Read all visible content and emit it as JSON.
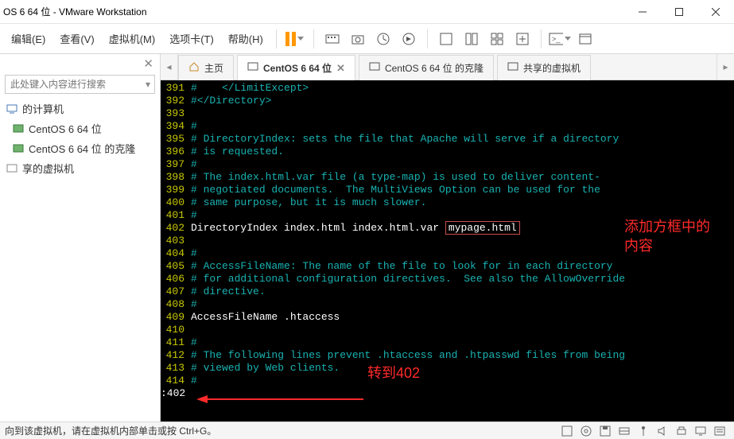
{
  "title": "OS 6 64 位 - VMware Workstation",
  "menus": {
    "edit": "编辑(E)",
    "view": "查看(V)",
    "vm": "虚拟机(M)",
    "tabs": "选项卡(T)",
    "help": "帮助(H)"
  },
  "sidebar": {
    "searchPlaceholder": "此处键入内容进行搜索",
    "computer": "的计算机",
    "vm1": "CentOS 6 64 位",
    "vm2": "CentOS 6 64 位 的克隆",
    "shared": "享的虚拟机"
  },
  "tabs": [
    "主页",
    "CentOS 6 64 位",
    "CentOS 6 64 位 的克隆",
    "共享的虚拟机"
  ],
  "term": {
    "lines": [
      {
        "n": "391",
        "t": "#    </LimitExcept>",
        "c": "tcomment"
      },
      {
        "n": "392",
        "t": "#</Directory>",
        "c": "tcomment"
      },
      {
        "n": "393",
        "t": "",
        "c": "tcomment"
      },
      {
        "n": "394",
        "t": "#",
        "c": "tcomment"
      },
      {
        "n": "395",
        "t": "# DirectoryIndex: sets the file that Apache will serve if a directory",
        "c": "tcomment"
      },
      {
        "n": "396",
        "t": "# is requested.",
        "c": "tcomment"
      },
      {
        "n": "397",
        "t": "#",
        "c": "tcomment"
      },
      {
        "n": "398",
        "t": "# The index.html.var file (a type-map) is used to deliver content-",
        "c": "tcomment"
      },
      {
        "n": "399",
        "t": "# negotiated documents.  The MultiViews Option can be used for the",
        "c": "tcomment"
      },
      {
        "n": "400",
        "t": "# same purpose, but it is much slower.",
        "c": "tcomment"
      },
      {
        "n": "401",
        "t": "#",
        "c": "tcomment"
      },
      {
        "n": "402",
        "pre": "DirectoryIndex",
        "mid": " index.html index.html.var ",
        "box": "mypage.html"
      },
      {
        "n": "403",
        "t": "",
        "c": "tcomment"
      },
      {
        "n": "404",
        "t": "#",
        "c": "tcomment"
      },
      {
        "n": "405",
        "t": "# AccessFileName: The name of the file to look for in each directory",
        "c": "tcomment"
      },
      {
        "n": "406",
        "t": "# for additional configuration directives.  See also the AllowOverride",
        "c": "tcomment"
      },
      {
        "n": "407",
        "t": "# directive.",
        "c": "tcomment"
      },
      {
        "n": "408",
        "t": "#",
        "c": "tcomment"
      },
      {
        "n": "409",
        "pre": "AccessFileName",
        "mid": " .htaccess"
      },
      {
        "n": "410",
        "t": "",
        "c": "tcomment"
      },
      {
        "n": "411",
        "t": "#",
        "c": "tcomment"
      },
      {
        "n": "412",
        "t": "# The following lines prevent .htaccess and .htpasswd files from being",
        "c": "tcomment"
      },
      {
        "n": "413",
        "t": "# viewed by Web clients.",
        "c": "tcomment"
      },
      {
        "n": "414",
        "t": "#",
        "c": "tcomment"
      }
    ],
    "cmdline": ":402"
  },
  "annotations": {
    "boxNote": "添加方框中的内容",
    "gotoNote": "转到402"
  },
  "statusbar": "向到该虚拟机，请在虚拟机内部单击或按 Ctrl+G。"
}
